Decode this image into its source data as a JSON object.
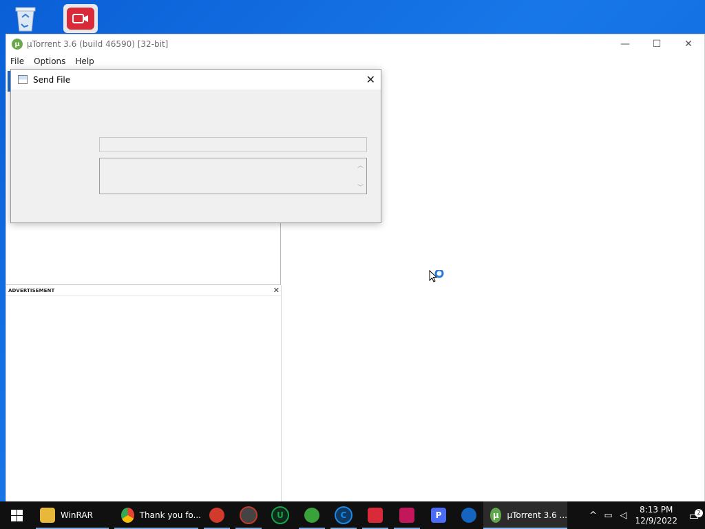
{
  "desktop": {
    "icons": [
      {
        "name": "recycle-bin"
      },
      {
        "name": "screen-recorder-app"
      }
    ]
  },
  "window": {
    "title": "µTorrent 3.6  (build 46590) [32-bit]",
    "menu": [
      "File",
      "Options",
      "Help"
    ],
    "controls": {
      "minimize": "—",
      "maximize": "☐",
      "close": "✕"
    },
    "ad": {
      "label": "ADVERTISEMENT",
      "close": "✕"
    }
  },
  "dialog": {
    "title": "Send File",
    "close": "✕",
    "field_value": "",
    "memo_value": ""
  },
  "taskbar": {
    "items": [
      {
        "label": "WinRAR",
        "icon": "folder-icon",
        "color": "#e8b83a"
      },
      {
        "label": "Thank you fo...",
        "icon": "chrome-icon",
        "color": "#e84335"
      },
      {
        "label": "",
        "icon": "disc-burner-icon",
        "color": "#d23a2c"
      },
      {
        "label": "",
        "icon": "media-icon",
        "color": "#c0392b"
      },
      {
        "label": "",
        "icon": "u-app-icon",
        "color": "#18a34a"
      },
      {
        "label": "",
        "icon": "download-manager-icon",
        "color": "#3aa23a"
      },
      {
        "label": "",
        "icon": "c-app-icon",
        "color": "#1e88e5"
      },
      {
        "label": "",
        "icon": "recorder-icon",
        "color": "#d92a3a"
      },
      {
        "label": "",
        "icon": "video-editor-icon",
        "color": "#c2185b"
      },
      {
        "label": "",
        "icon": "p-app-icon",
        "color": "#4a6cf7"
      },
      {
        "label": "",
        "icon": "vpn-shield-icon",
        "color": "#1565c0"
      },
      {
        "label": "µTorrent 3.6 ...",
        "icon": "utorrent-icon",
        "color": "#5fa84a"
      }
    ],
    "clock": {
      "time": "8:13 PM",
      "date": "12/9/2022"
    },
    "notification_count": "2"
  }
}
